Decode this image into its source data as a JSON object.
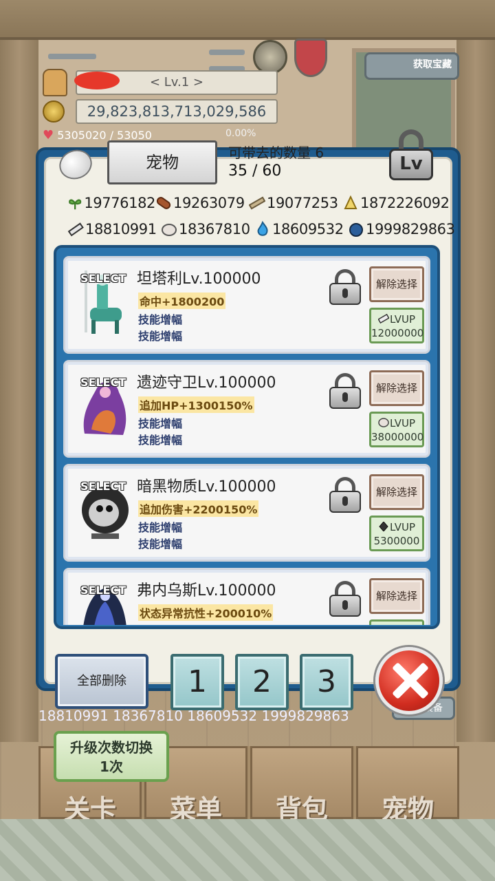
{
  "hud": {
    "level": "< Lv.1 >",
    "gold": "29,823,813,713,029,586",
    "hp": "5305020 / 53050",
    "exp_pct": "0.00%",
    "get_treasure_label": "获取宝藏"
  },
  "modal": {
    "title_tab": "宠物",
    "carry_label": "可带去的数量 6",
    "carry_count": "35 / 60",
    "lv_lock_label": "Lv"
  },
  "materials": [
    [
      {
        "icon": "herb-icon",
        "value": "19776182"
      },
      {
        "icon": "wood-log-icon",
        "value": "19263079"
      },
      {
        "icon": "plank-icon",
        "value": "19077253"
      },
      {
        "icon": "gold-ore-icon",
        "value": "1872226092"
      }
    ],
    [
      {
        "icon": "iron-ingot-icon",
        "value": "18810991"
      },
      {
        "icon": "stone-icon",
        "value": "18367810"
      },
      {
        "icon": "blue-flame-icon",
        "value": "18609532"
      },
      {
        "icon": "slime-orb-icon",
        "value": "1999829863"
      }
    ]
  ],
  "pets": [
    {
      "select": "SELECT",
      "name": "坦塔利Lv.100000",
      "stat": "命中+1800200",
      "skill1": "技能增幅",
      "skill2": "技能增幅",
      "deselect": "解除选择",
      "lvup_label": "LVUP",
      "lvup_cost": "12000000",
      "lvup_icon": "iron-ingot-icon"
    },
    {
      "select": "SELECT",
      "name": "遗迹守卫Lv.100000",
      "stat": "追加HP+1300150%",
      "skill1": "技能增幅",
      "skill2": "技能增幅",
      "deselect": "解除选择",
      "lvup_label": "LVUP",
      "lvup_cost": "38000000",
      "lvup_icon": "stone-icon"
    },
    {
      "select": "SELECT",
      "name": "暗黑物质Lv.100000",
      "stat": "追加伤害+2200150%",
      "skill1": "技能增幅",
      "skill2": "技能增幅",
      "deselect": "解除选择",
      "lvup_label": "LVUP",
      "lvup_cost": "5300000",
      "lvup_icon": "dark-crystal-icon"
    },
    {
      "select": "SELECT",
      "name": "弗内乌斯Lv.100000",
      "stat": "状态异常抗性+200010%",
      "skill1": "",
      "skill2": "",
      "deselect": "解除选择",
      "lvup_label": "",
      "lvup_cost": "",
      "lvup_icon": ""
    }
  ],
  "buttons": {
    "delete_all": "全部删除",
    "slot1": "1",
    "slot2": "2",
    "slot3": "3"
  },
  "bottom": {
    "materials_row": "18810991  18367810  18609532  1999829863",
    "all_equip": "全部装备",
    "upgrade_toggle_line1": "升级次数切换",
    "upgrade_toggle_line2": "1次",
    "nav": [
      "关卡",
      "菜单",
      "背包",
      "宠物"
    ]
  },
  "colors": {
    "modal_frame": "#1f5c8e",
    "stat_highlight": "#fbe6a3",
    "close_red": "#d12d20"
  }
}
